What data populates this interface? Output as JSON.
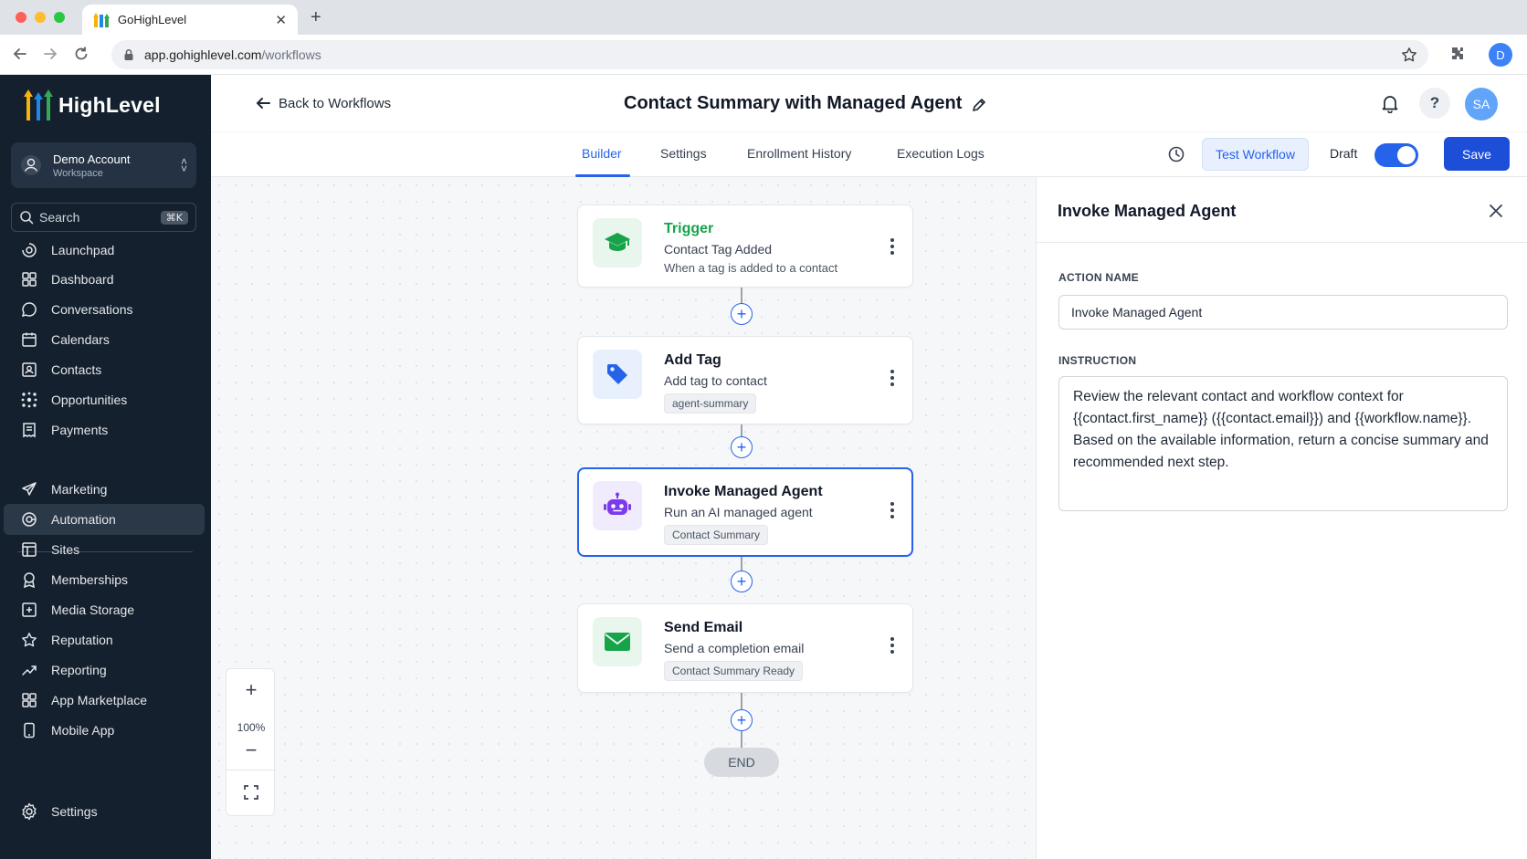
{
  "browser": {
    "tab_title": "GoHighLevel",
    "url_host": "app.gohighlevel.com",
    "url_path": "/workflows",
    "profile_initial": "D"
  },
  "sidebar": {
    "brand": "HighLevel",
    "account_name": "Demo Account",
    "account_sub": "Workspace",
    "search_label": "Search",
    "search_shortcut": "⌘K",
    "items": [
      {
        "label": "Launchpad",
        "icon": "launchpad-icon"
      },
      {
        "label": "Dashboard",
        "icon": "dashboard-icon"
      },
      {
        "label": "Conversations",
        "icon": "chat-icon"
      },
      {
        "label": "Calendars",
        "icon": "calendar-icon"
      },
      {
        "label": "Contacts",
        "icon": "contacts-icon"
      },
      {
        "label": "Opportunities",
        "icon": "opportunities-icon"
      },
      {
        "label": "Payments",
        "icon": "payments-icon"
      }
    ],
    "items2": [
      {
        "label": "Marketing",
        "icon": "send-icon"
      },
      {
        "label": "Automation",
        "icon": "automation-icon",
        "active": true
      },
      {
        "label": "Sites",
        "icon": "sites-icon"
      },
      {
        "label": "Memberships",
        "icon": "memberships-icon"
      },
      {
        "label": "Media Storage",
        "icon": "media-icon"
      },
      {
        "label": "Reputation",
        "icon": "star-icon"
      },
      {
        "label": "Reporting",
        "icon": "trend-icon"
      },
      {
        "label": "App Marketplace",
        "icon": "grid-icon"
      },
      {
        "label": "Mobile App",
        "icon": "phone-icon"
      }
    ],
    "settings_label": "Settings"
  },
  "header": {
    "back_label": "Back to Workflows",
    "title": "Contact Summary with Managed Agent",
    "avatar_initials": "SA",
    "help_glyph": "?"
  },
  "subnav": {
    "tabs": [
      {
        "label": "Builder",
        "active": true
      },
      {
        "label": "Settings"
      },
      {
        "label": "Enrollment History"
      },
      {
        "label": "Execution Logs"
      }
    ],
    "test_label": "Test Workflow",
    "draft_label": "Draft",
    "save_label": "Save"
  },
  "canvas": {
    "nodes": [
      {
        "title": "Trigger",
        "subtitle": "Contact Tag Added",
        "description": "When a tag is added to a contact",
        "icon": "graduation-cap-icon"
      },
      {
        "title": "Add Tag",
        "subtitle": "Add tag to contact",
        "chip": "agent-summary",
        "icon": "tag-icon"
      },
      {
        "title": "Invoke Managed Agent",
        "subtitle": "Run an AI managed agent",
        "chip": "Contact Summary",
        "icon": "robot-icon",
        "selected": true
      },
      {
        "title": "Send Email",
        "subtitle": "Send a completion email",
        "chip": "Contact Summary Ready",
        "icon": "mail-icon"
      }
    ],
    "end_label": "END",
    "zoom_level": "100%",
    "colors": {
      "trigger": "#16a34a",
      "accent": "#2563eb",
      "agent": "#7c3aed",
      "email": "#16a34a"
    }
  },
  "panel": {
    "title": "Invoke Managed Agent",
    "action_name_label": "ACTION NAME",
    "action_name_value": "Invoke Managed Agent",
    "instruction_label": "INSTRUCTION",
    "instruction_value": "Review the relevant contact and workflow context for {{contact.first_name}} ({{contact.email}}) and {{workflow.name}}. Based on the available information, return a concise summary and recommended next step."
  }
}
